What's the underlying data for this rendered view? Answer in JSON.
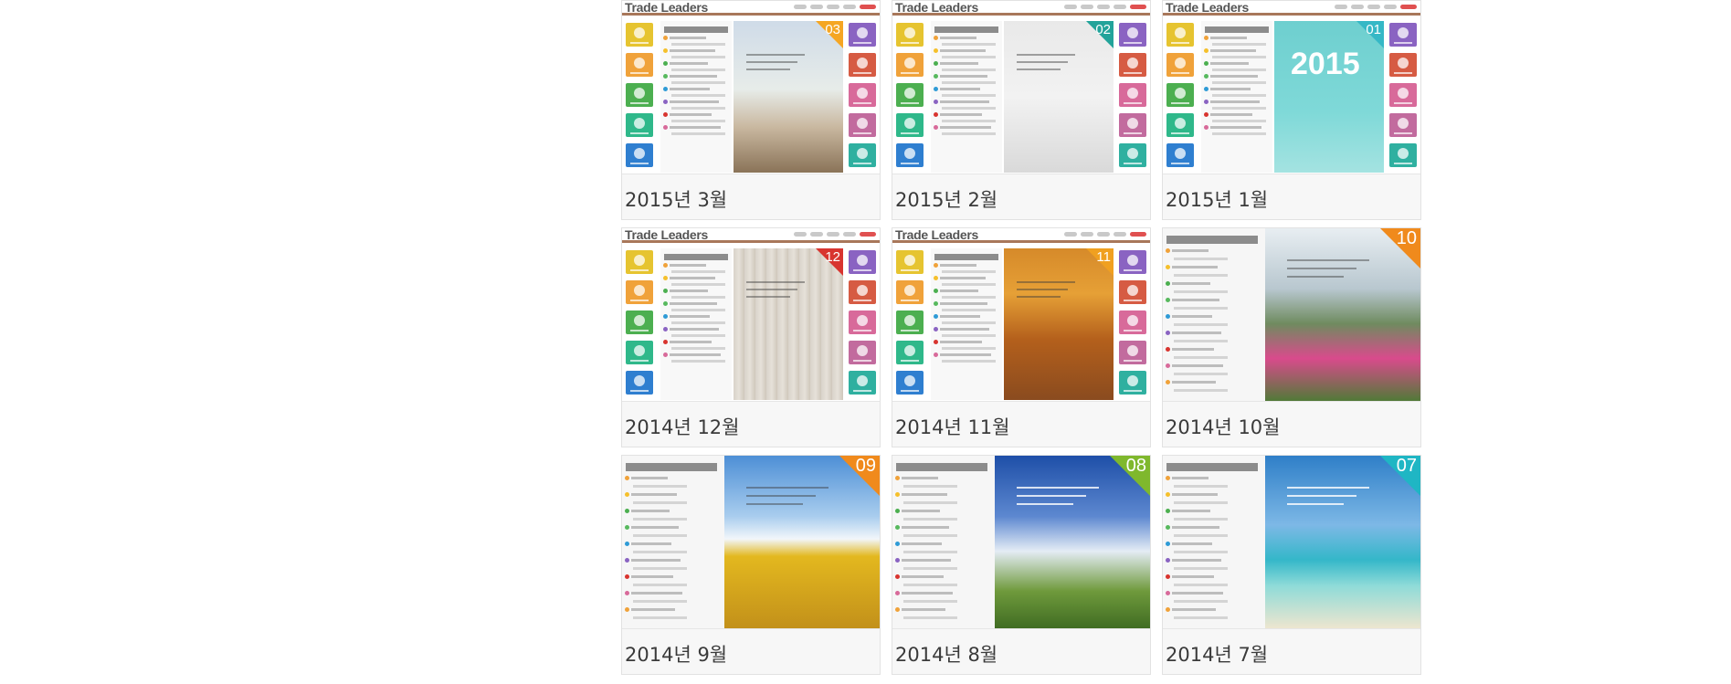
{
  "issues": [
    {
      "caption": "2015년 3월",
      "number": "03",
      "layout": "tl",
      "photo": "magnolia",
      "corner_color": "#f5a623",
      "thumbnail_title": "Trade Leaders"
    },
    {
      "caption": "2015년 2월",
      "number": "02",
      "layout": "tl",
      "photo": "house",
      "corner_color": "#22a39a",
      "thumbnail_title": "Trade Leaders"
    },
    {
      "caption": "2015년 1월",
      "number": "01",
      "layout": "tl",
      "photo": "2015",
      "corner_color": "#35b8c6",
      "thumbnail_title": "Trade Leaders",
      "cover_text": "2015"
    },
    {
      "caption": "2014년 12월",
      "number": "12",
      "layout": "tl",
      "photo": "wood",
      "corner_color": "#d8342f",
      "thumbnail_title": "Trade Leaders"
    },
    {
      "caption": "2014년 11월",
      "number": "11",
      "layout": "tl",
      "photo": "autumn",
      "corner_color": "#f0a020",
      "thumbnail_title": "Trade Leaders"
    },
    {
      "caption": "2014년 10월",
      "number": "10",
      "layout": "full",
      "photo": "cosmos",
      "corner_color": "#f08a1c"
    },
    {
      "caption": "2014년 9월",
      "number": "09",
      "layout": "full",
      "photo": "sunflower",
      "corner_color": "#f08a1c"
    },
    {
      "caption": "2014년 8월",
      "number": "08",
      "layout": "full",
      "photo": "clouds",
      "corner_color": "#7fb82d"
    },
    {
      "caption": "2014년 7월",
      "number": "07",
      "layout": "full",
      "photo": "beach",
      "corner_color": "#1fb6c4"
    }
  ],
  "colors": {
    "tiles_left": [
      "#e6c430",
      "#f0a23a",
      "#4caf50",
      "#2fb88a",
      "#2f7fd0"
    ],
    "tiles_right": [
      "#8a63c2",
      "#d65b43",
      "#d86a9a",
      "#c26b9e",
      "#2fb0a0"
    ],
    "content_dots": [
      "#f0a23a",
      "#f5c02c",
      "#4caf50",
      "#57b95e",
      "#2f9bd6",
      "#8a63c2",
      "#d8342f",
      "#d86a9a"
    ]
  }
}
